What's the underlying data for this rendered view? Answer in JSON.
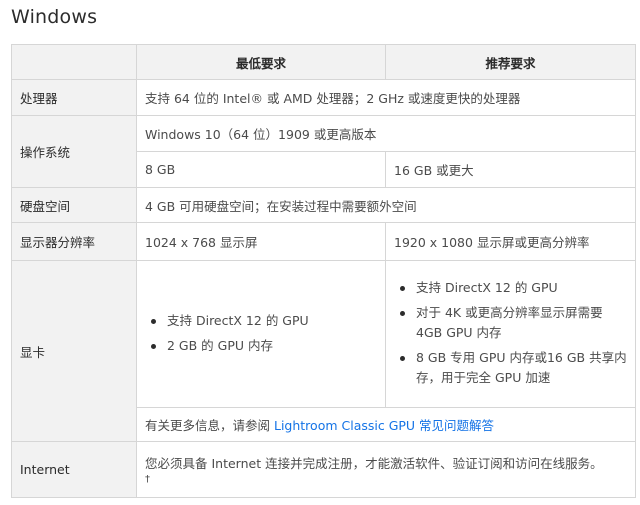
{
  "page": {
    "title": "Windows"
  },
  "table": {
    "headers": {
      "min": "最低要求",
      "recommended": "推荐要求"
    },
    "rows": {
      "cpu": {
        "label": "处理器",
        "value": "支持 64 位的 Intel® 或 AMD 处理器；2 GHz 或速度更快的处理器"
      },
      "os": {
        "label": "操作系统",
        "value": "Windows 10（64 位）1909 或更高版本"
      },
      "ram": {
        "label": "",
        "min": "8 GB",
        "recommended": "16 GB 或更大"
      },
      "disk": {
        "label": "硬盘空间",
        "value": "4 GB 可用硬盘空间；在安装过程中需要额外空间"
      },
      "resolution": {
        "label": "显示器分辨率",
        "min": "1024 x 768 显示屏",
        "recommended": "1920 x 1080 显示屏或更高分辨率"
      },
      "gpu": {
        "label": "显卡",
        "min_items": [
          "支持 DirectX 12 的 GPU",
          "2 GB 的 GPU 内存"
        ],
        "recommended_items": [
          "支持 DirectX 12 的 GPU",
          "对于 4K 或更高分辨率显示屏需要 4GB GPU 内存",
          "8 GB 专用 GPU 内存或16 GB 共享内存，用于完全 GPU 加速"
        ],
        "more_info_prefix": "有关更多信息，请参阅 ",
        "more_info_link": "Lightroom Classic GPU 常见问题解答"
      },
      "internet": {
        "label": "Internet",
        "value": "您必须具备 Internet 连接并完成注册，才能激活软件、验证订阅和访问在线服务。",
        "footnote": "†"
      }
    }
  }
}
